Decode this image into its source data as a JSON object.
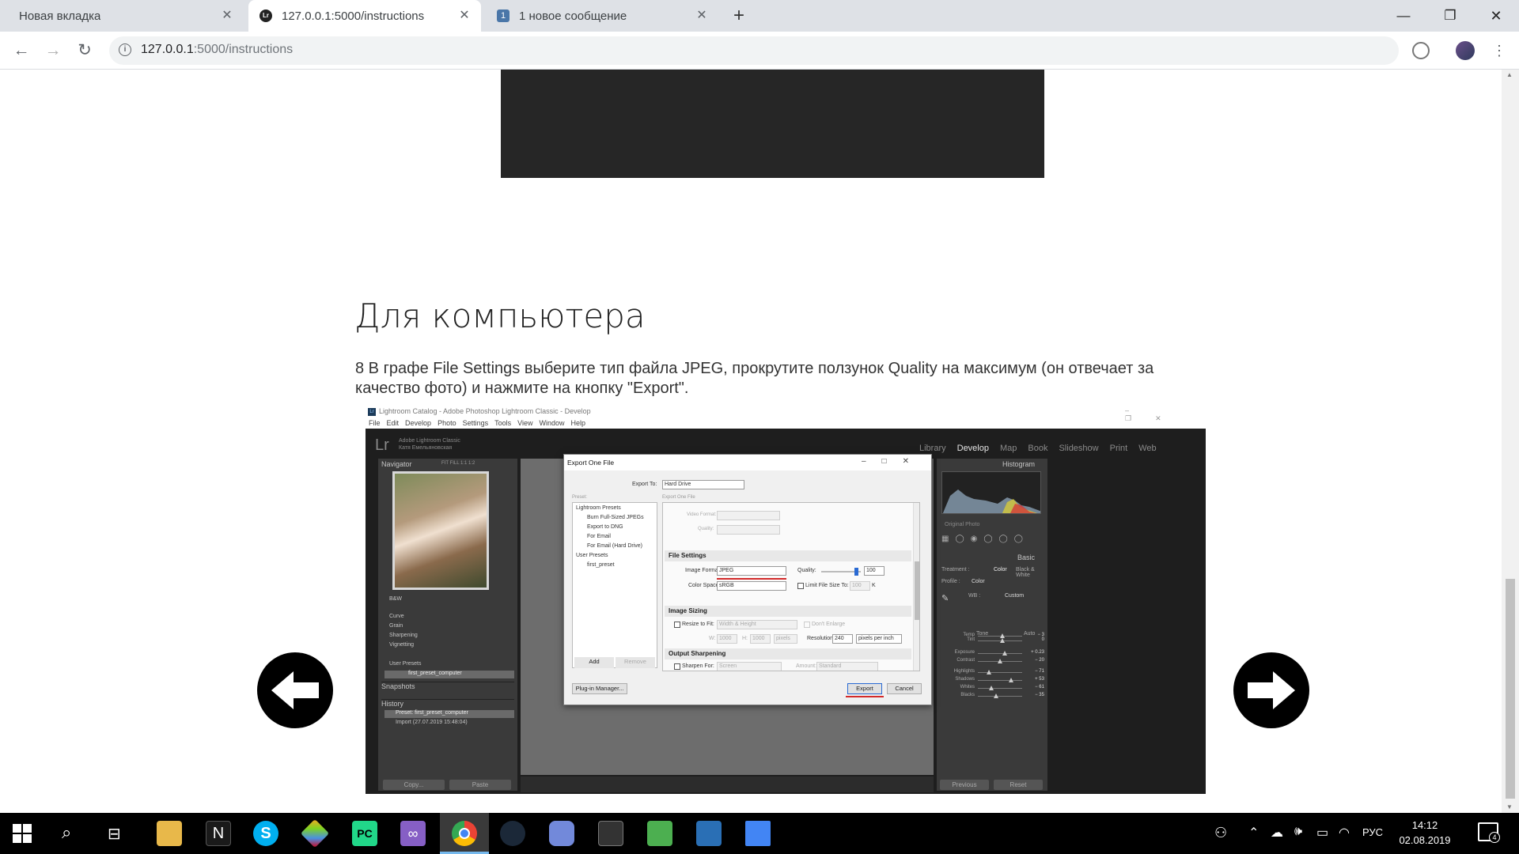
{
  "tabs": [
    {
      "title": "Новая вкладка"
    },
    {
      "title": "127.0.0.1:5000/instructions",
      "favicon": "Lr"
    },
    {
      "title": "1 новое сообщение",
      "favicon": "1"
    }
  ],
  "address": {
    "host": "127.0.0.1",
    "rest": ":5000/instructions"
  },
  "page": {
    "heading": "Для компьютера",
    "step_text": "8 В графе File Settings выберите тип файла JPEG, прокрутите ползунок Quality на максимум (он отвечает за качество фото) и нажмите на кнопку \"Export\"."
  },
  "lr": {
    "window_title": "Lightroom Catalog - Adobe Photoshop Lightroom Classic - Develop",
    "menu": [
      "File",
      "Edit",
      "Develop",
      "Photo",
      "Settings",
      "Tools",
      "View",
      "Window",
      "Help"
    ],
    "logo": "Lr",
    "brand": "Adobe Lightroom Classic",
    "user": "Катя Емельяновская",
    "modules": [
      "Library",
      "Develop",
      "Map",
      "Book",
      "Slideshow",
      "Print",
      "Web"
    ],
    "navigator": "Navigator",
    "nav_opts": "FIT  FILL  1:1  1:2",
    "presets_left": [
      "B&W",
      "Curve",
      "Grain",
      "Sharpening",
      "Vignetting"
    ],
    "user_presets_label": "User Presets",
    "left_user_preset": "first_preset_computer",
    "snapshots": "Snapshots",
    "history": "History",
    "history_items": [
      "Preset: first_preset_computer",
      "Import (27.07.2019 15:48:04)"
    ],
    "copy_btn": "Copy...",
    "paste_btn": "Paste",
    "histogram": "Histogram",
    "original_photo": "Original Photo",
    "basic": "Basic",
    "treatment": "Treatment :",
    "color": "Color",
    "bw": "Black & White",
    "profile": "Profile :",
    "profile_val": "Color",
    "wb": "WB :",
    "wb_val": "Custom",
    "sliders": [
      {
        "name": "Temp",
        "val": "− 3"
      },
      {
        "name": "Tint",
        "val": "0"
      },
      {
        "name": "Exposure",
        "val": "+ 0.23"
      },
      {
        "name": "Contrast",
        "val": "− 20"
      },
      {
        "name": "Highlights",
        "val": "− 71"
      },
      {
        "name": "Shadows",
        "val": "+ 53"
      },
      {
        "name": "Whites",
        "val": "− 61"
      },
      {
        "name": "Blacks",
        "val": "− 35"
      }
    ],
    "tone": "Tone",
    "auto": "Auto",
    "previous": "Previous",
    "reset": "Reset"
  },
  "dialog": {
    "title": "Export One File",
    "export_to_label": "Export To:",
    "export_to": "Hard Drive",
    "preset_label": "Preset:",
    "panel_label": "Export One File",
    "presets": [
      "Lightroom Presets",
      "Burn Full-Sized JPEGs",
      "Export to DNG",
      "For Email",
      "For Email (Hard Drive)",
      "User Presets",
      "first_preset"
    ],
    "add": "Add",
    "remove": "Remove",
    "video_format": "Video Format:",
    "quality_dim": "Quality:",
    "file_settings": "File Settings",
    "image_format_label": "Image Format:",
    "image_format": "JPEG",
    "quality_label": "Quality:",
    "quality_value": "100",
    "color_space_label": "Color Space:",
    "color_space": "sRGB",
    "limit_label": "Limit File Size To:",
    "limit_value": "100",
    "limit_unit": "K",
    "image_sizing": "Image Sizing",
    "resize_label": "Resize to Fit:",
    "resize_value": "Width & Height",
    "dont_enlarge": "Don't Enlarge",
    "w_label": "W:",
    "w_value": "1000",
    "h_label": "H:",
    "h_value": "1000",
    "unit": "pixels",
    "resolution_label": "Resolution:",
    "resolution_value": "240",
    "resolution_unit": "pixels per inch",
    "output_sharpening": "Output Sharpening",
    "sharpen_label": "Sharpen For:",
    "sharpen_value": "Screen",
    "amount_label": "Amount:",
    "amount_value": "Standard",
    "plugin_manager": "Plug-in Manager...",
    "export": "Export",
    "cancel": "Cancel"
  },
  "taskbar": {
    "lang": "РУС",
    "time": "14:12",
    "date": "02.08.2019",
    "notifications": "4"
  }
}
